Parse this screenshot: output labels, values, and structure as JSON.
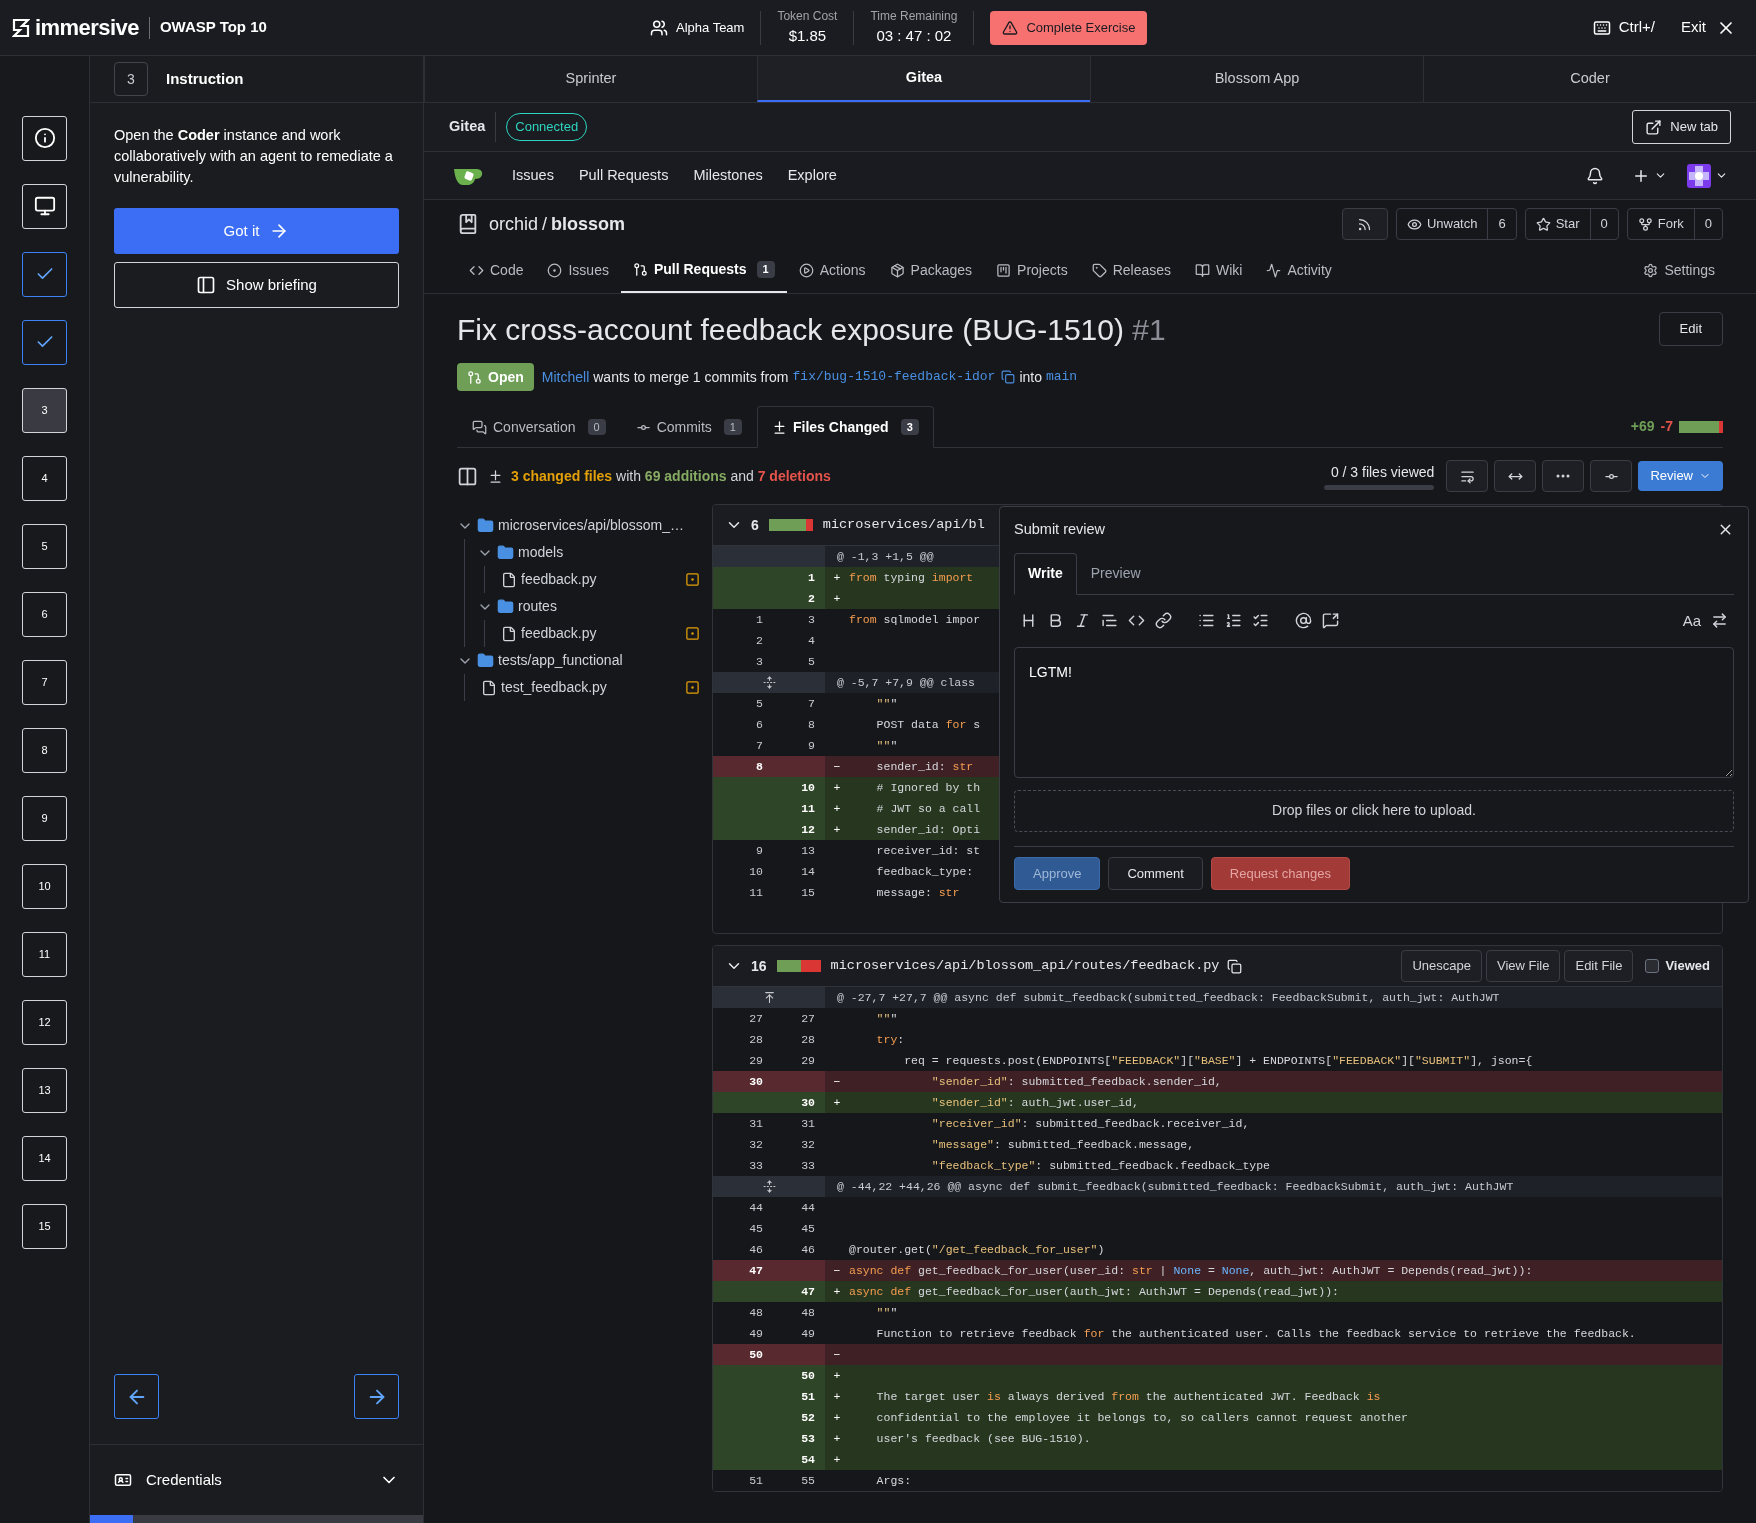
{
  "app_bar": {
    "brand": "immersive",
    "course": "OWASP Top 10",
    "team": "Alpha Team",
    "token_cost": {
      "label": "Token Cost",
      "value": "$1.85"
    },
    "time_remaining": {
      "label": "Time Remaining",
      "value": "03 : 47 : 02"
    },
    "complete_button": "Complete Exercise",
    "shortcut": "Ctrl+/",
    "exit": "Exit"
  },
  "rail": [
    {
      "kind": "info",
      "selected": false
    },
    {
      "kind": "screen",
      "selected": false
    },
    {
      "kind": "done",
      "selected": false
    },
    {
      "kind": "done",
      "selected": false
    },
    {
      "kind": "step",
      "label": "3",
      "selected": true
    },
    {
      "kind": "step",
      "label": "4",
      "selected": false
    },
    {
      "kind": "step",
      "label": "5",
      "selected": false
    },
    {
      "kind": "step",
      "label": "6",
      "selected": false
    },
    {
      "kind": "step",
      "label": "7",
      "selected": false
    },
    {
      "kind": "step",
      "label": "8",
      "selected": false
    },
    {
      "kind": "step",
      "label": "9",
      "selected": false
    },
    {
      "kind": "step",
      "label": "10",
      "selected": false
    },
    {
      "kind": "step",
      "label": "11",
      "selected": false
    },
    {
      "kind": "step",
      "label": "12",
      "selected": false
    },
    {
      "kind": "step",
      "label": "13",
      "selected": false
    },
    {
      "kind": "step",
      "label": "14",
      "selected": false
    },
    {
      "kind": "step",
      "label": "15",
      "selected": false
    }
  ],
  "instruction": {
    "step": "3",
    "title": "Instruction",
    "text": "Open the **Coder** instance and work collaboratively with an agent to remediate a vulnerability.",
    "got_it": "Got it",
    "show_briefing": "Show briefing",
    "credentials": "Credentials",
    "progress": {
      "level": 0.13
    }
  },
  "workspace_tabs": [
    {
      "label": "Sprinter",
      "selected": false
    },
    {
      "label": "Gitea",
      "selected": true
    },
    {
      "label": "Blossom App",
      "selected": false
    },
    {
      "label": "Coder",
      "selected": false
    }
  ],
  "gitea_bar": {
    "title": "Gitea",
    "status": "Connected",
    "new_tab": "New tab"
  },
  "gitea_nav": [
    "Issues",
    "Pull Requests",
    "Milestones",
    "Explore"
  ],
  "repo": {
    "owner": "orchid",
    "separator": "/",
    "name": "blossom",
    "watch": {
      "label": "Unwatch",
      "count": "6"
    },
    "star": {
      "label": "Star",
      "count": "0"
    },
    "fork": {
      "label": "Fork",
      "count": "0"
    },
    "tabs": [
      {
        "label": "Code",
        "selected": false
      },
      {
        "label": "Issues",
        "selected": false
      },
      {
        "label": "Pull Requests",
        "count": "1",
        "selected": true
      },
      {
        "label": "Actions",
        "selected": false
      },
      {
        "label": "Packages",
        "selected": false
      },
      {
        "label": "Projects",
        "selected": false
      },
      {
        "label": "Releases",
        "selected": false
      },
      {
        "label": "Wiki",
        "selected": false
      },
      {
        "label": "Activity",
        "selected": false
      }
    ],
    "settings": "Settings"
  },
  "pr": {
    "title": "Fix cross-account feedback exposure (BUG-1510)",
    "number": "#1",
    "edit": "Edit",
    "state": "Open",
    "author": "Mitchell",
    "merge_text": "wants to merge 1 commits from",
    "head": "fix/bug-1510-feedback-idor",
    "into": "into",
    "base": "main",
    "tabs": [
      {
        "label": "Conversation",
        "count": "0",
        "selected": false
      },
      {
        "label": "Commits",
        "count": "1",
        "selected": false
      },
      {
        "label": "Files Changed",
        "count": "3",
        "selected": true
      }
    ],
    "additions": "+69",
    "deletions": "-7",
    "level": 0.9
  },
  "summary": {
    "parts": [
      {
        "text": "3 changed files",
        "kind": "files"
      },
      {
        "text": "with",
        "kind": "plain"
      },
      {
        "text": "69 additions",
        "kind": "added"
      },
      {
        "text": "and",
        "kind": "plain"
      },
      {
        "text": "7 deletions",
        "kind": "deleted"
      }
    ],
    "viewed": {
      "text": "0 / 3 files viewed",
      "level": 0
    },
    "review": "Review"
  },
  "file_tree": [
    {
      "name": "microservices/api/blossom_…",
      "kind": "folder",
      "expanded": true,
      "children": [
        {
          "name": "models",
          "kind": "folder",
          "expanded": true,
          "children": [
            {
              "name": "feedback.py",
              "kind": "file"
            }
          ]
        },
        {
          "name": "routes",
          "kind": "folder",
          "expanded": true,
          "children": [
            {
              "name": "feedback.py",
              "kind": "file"
            }
          ]
        }
      ]
    },
    {
      "name": "tests/app_functional",
      "kind": "folder",
      "expanded": true,
      "children": [
        {
          "name": "test_feedback.py",
          "kind": "file"
        }
      ]
    }
  ],
  "diffs": [
    {
      "count": "6",
      "path": "microservices/api/bl",
      "level": 0.85,
      "lines": [
        {
          "kind": "hunkplain",
          "code": "@ -1,3 +1,5 @@"
        },
        {
          "kind": "add",
          "new": "1",
          "sign": "+",
          "code": "from typing import"
        },
        {
          "kind": "add",
          "new": "2",
          "sign": "+"
        },
        {
          "kind": "ctx",
          "old": "1",
          "new": "3",
          "code": "from sqlmodel impor"
        },
        {
          "kind": "ctx",
          "old": "2",
          "new": "4"
        },
        {
          "kind": "ctx",
          "old": "3",
          "new": "5"
        },
        {
          "kind": "hunk",
          "code": "@ -5,7 +7,9 @@ class"
        },
        {
          "kind": "ctx",
          "old": "5",
          "new": "7",
          "code": "    \"\"\""
        },
        {
          "kind": "ctx",
          "old": "6",
          "new": "8",
          "code": "    POST data for s"
        },
        {
          "kind": "ctx",
          "old": "7",
          "new": "9",
          "code": "    \"\"\""
        },
        {
          "kind": "del",
          "old": "8",
          "sign": "−",
          "code": "    sender_id: str"
        },
        {
          "kind": "add",
          "new": "10",
          "sign": "+",
          "code": "    # Ignored by th"
        },
        {
          "kind": "add",
          "new": "11",
          "sign": "+",
          "code": "    # JWT so a call"
        },
        {
          "kind": "add",
          "new": "12",
          "sign": "+",
          "code": "    sender_id: Opti"
        },
        {
          "kind": "ctx",
          "old": "9",
          "new": "13",
          "code": "    receiver_id: st"
        },
        {
          "kind": "ctx",
          "old": "10",
          "new": "14",
          "code": "    feedback_type:"
        },
        {
          "kind": "ctx",
          "old": "11",
          "new": "15",
          "code": "    message: str"
        }
      ]
    },
    {
      "count": "16",
      "path": "microservices/api/blossom_api/routes/feedback.py",
      "level": 0.55,
      "buttons": [
        "Unescape",
        "View File",
        "Edit File"
      ],
      "viewed": {
        "label": "Viewed",
        "checked": false
      },
      "lines": [
        {
          "kind": "hunkup",
          "code": "@ -27,7 +27,7 @@ async def submit_feedback(submitted_feedback: FeedbackSubmit, auth_jwt: AuthJWT"
        },
        {
          "kind": "ctx",
          "old": "27",
          "new": "27",
          "code": "    \"\"\""
        },
        {
          "kind": "ctx",
          "old": "28",
          "new": "28",
          "code": "    try:"
        },
        {
          "kind": "ctx",
          "old": "29",
          "new": "29",
          "code": "        req = requests.post(ENDPOINTS[\"FEEDBACK\"][\"BASE\"] + ENDPOINTS[\"FEEDBACK\"][\"SUBMIT\"], json={"
        },
        {
          "kind": "del",
          "old": "30",
          "sign": "−",
          "code": "            \"sender_id\": submitted_feedback.sender_id,"
        },
        {
          "kind": "add",
          "new": "30",
          "sign": "+",
          "code": "            \"sender_id\": auth_jwt.user_id,"
        },
        {
          "kind": "ctx",
          "old": "31",
          "new": "31",
          "code": "            \"receiver_id\": submitted_feedback.receiver_id,"
        },
        {
          "kind": "ctx",
          "old": "32",
          "new": "32",
          "code": "            \"message\": submitted_feedback.message,"
        },
        {
          "kind": "ctx",
          "old": "33",
          "new": "33",
          "code": "            \"feedback_type\": submitted_feedback.feedback_type"
        },
        {
          "kind": "hunk",
          "code": "@ -44,22 +44,26 @@ async def submit_feedback(submitted_feedback: FeedbackSubmit, auth_jwt: AuthJWT"
        },
        {
          "kind": "ctx",
          "old": "44",
          "new": "44"
        },
        {
          "kind": "ctx",
          "old": "45",
          "new": "45"
        },
        {
          "kind": "ctx",
          "old": "46",
          "new": "46",
          "code": "@router.get(\"/get_feedback_for_user\")"
        },
        {
          "kind": "del",
          "old": "47",
          "sign": "−",
          "code": "async def get_feedback_for_user(user_id: str | None = None, auth_jwt: AuthJWT = Depends(read_jwt)):"
        },
        {
          "kind": "add",
          "new": "47",
          "sign": "+",
          "code": "async def get_feedback_for_user(auth_jwt: AuthJWT = Depends(read_jwt)):"
        },
        {
          "kind": "ctx",
          "old": "48",
          "new": "48",
          "code": "    \"\"\""
        },
        {
          "kind": "ctx",
          "old": "49",
          "new": "49",
          "code": "    Function to retrieve feedback for the authenticated user. Calls the feedback service to retrieve the feedback."
        },
        {
          "kind": "del",
          "old": "50",
          "sign": "−"
        },
        {
          "kind": "add",
          "new": "50",
          "sign": "+"
        },
        {
          "kind": "add",
          "new": "51",
          "sign": "+",
          "code": "    The target user is always derived from the authenticated JWT. Feedback is"
        },
        {
          "kind": "add",
          "new": "52",
          "sign": "+",
          "code": "    confidential to the employee it belongs to, so callers cannot request another"
        },
        {
          "kind": "add",
          "new": "53",
          "sign": "+",
          "code": "    user's feedback (see BUG-1510)."
        },
        {
          "kind": "add",
          "new": "54",
          "sign": "+"
        },
        {
          "kind": "ctx",
          "old": "51",
          "new": "55",
          "code": "    Args:"
        }
      ]
    }
  ],
  "review": {
    "title": "Submit review",
    "tabs": [
      {
        "label": "Write",
        "selected": true
      },
      {
        "label": "Preview",
        "selected": false
      }
    ],
    "font_toggle": "Aa",
    "text": "LGTM!",
    "upload": "Drop files or click here to upload.",
    "buttons": [
      {
        "label": "Approve",
        "kind": "approve"
      },
      {
        "label": "Comment",
        "kind": "comment"
      },
      {
        "label": "Request changes",
        "kind": "reject"
      }
    ]
  }
}
